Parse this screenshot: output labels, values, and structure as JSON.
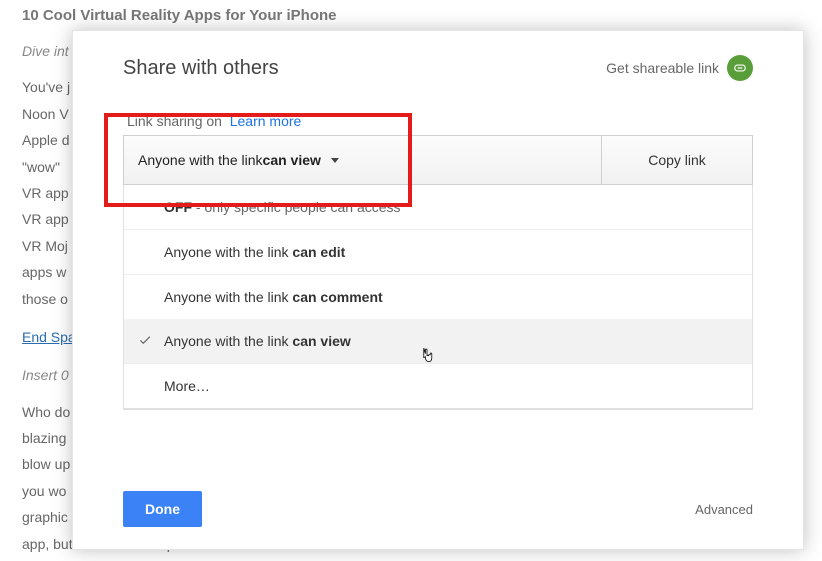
{
  "article": {
    "title": "10 Cool Virtual Reality Apps for Your iPhone",
    "subtitle": "Dive int",
    "p1": "You've j",
    "p2": "Noon V",
    "p3": "Apple d",
    "p4": "\"wow\"",
    "p5": "VR app",
    "p6": "VR app",
    "p7": "VR Moj",
    "p8": "apps w",
    "p9": "those o",
    "link1": "End Spa",
    "p10": "Insert 0",
    "p11": "Who do",
    "p12": "blazing",
    "p13": "blow up",
    "p14": "you wo",
    "p15": "graphic",
    "p16": "app, but the admission price is more than worth the ride"
  },
  "dialog": {
    "title": "Share with others",
    "get_link": "Get shareable link",
    "link_sharing": "Link sharing on",
    "learn_more": "Learn more",
    "selector_prefix": "Anyone with the link ",
    "selector_bold": "can view",
    "copy_link": "Copy link",
    "options": {
      "off_bold": "OFF",
      "off_rest": " - only specific people can access",
      "edit_prefix": "Anyone with the link ",
      "edit_bold": "can edit",
      "comment_prefix": "Anyone with the link ",
      "comment_bold": "can comment",
      "view_prefix": "Anyone with the link ",
      "view_bold": "can view",
      "more": "More…"
    },
    "done": "Done",
    "advanced": "Advanced"
  }
}
